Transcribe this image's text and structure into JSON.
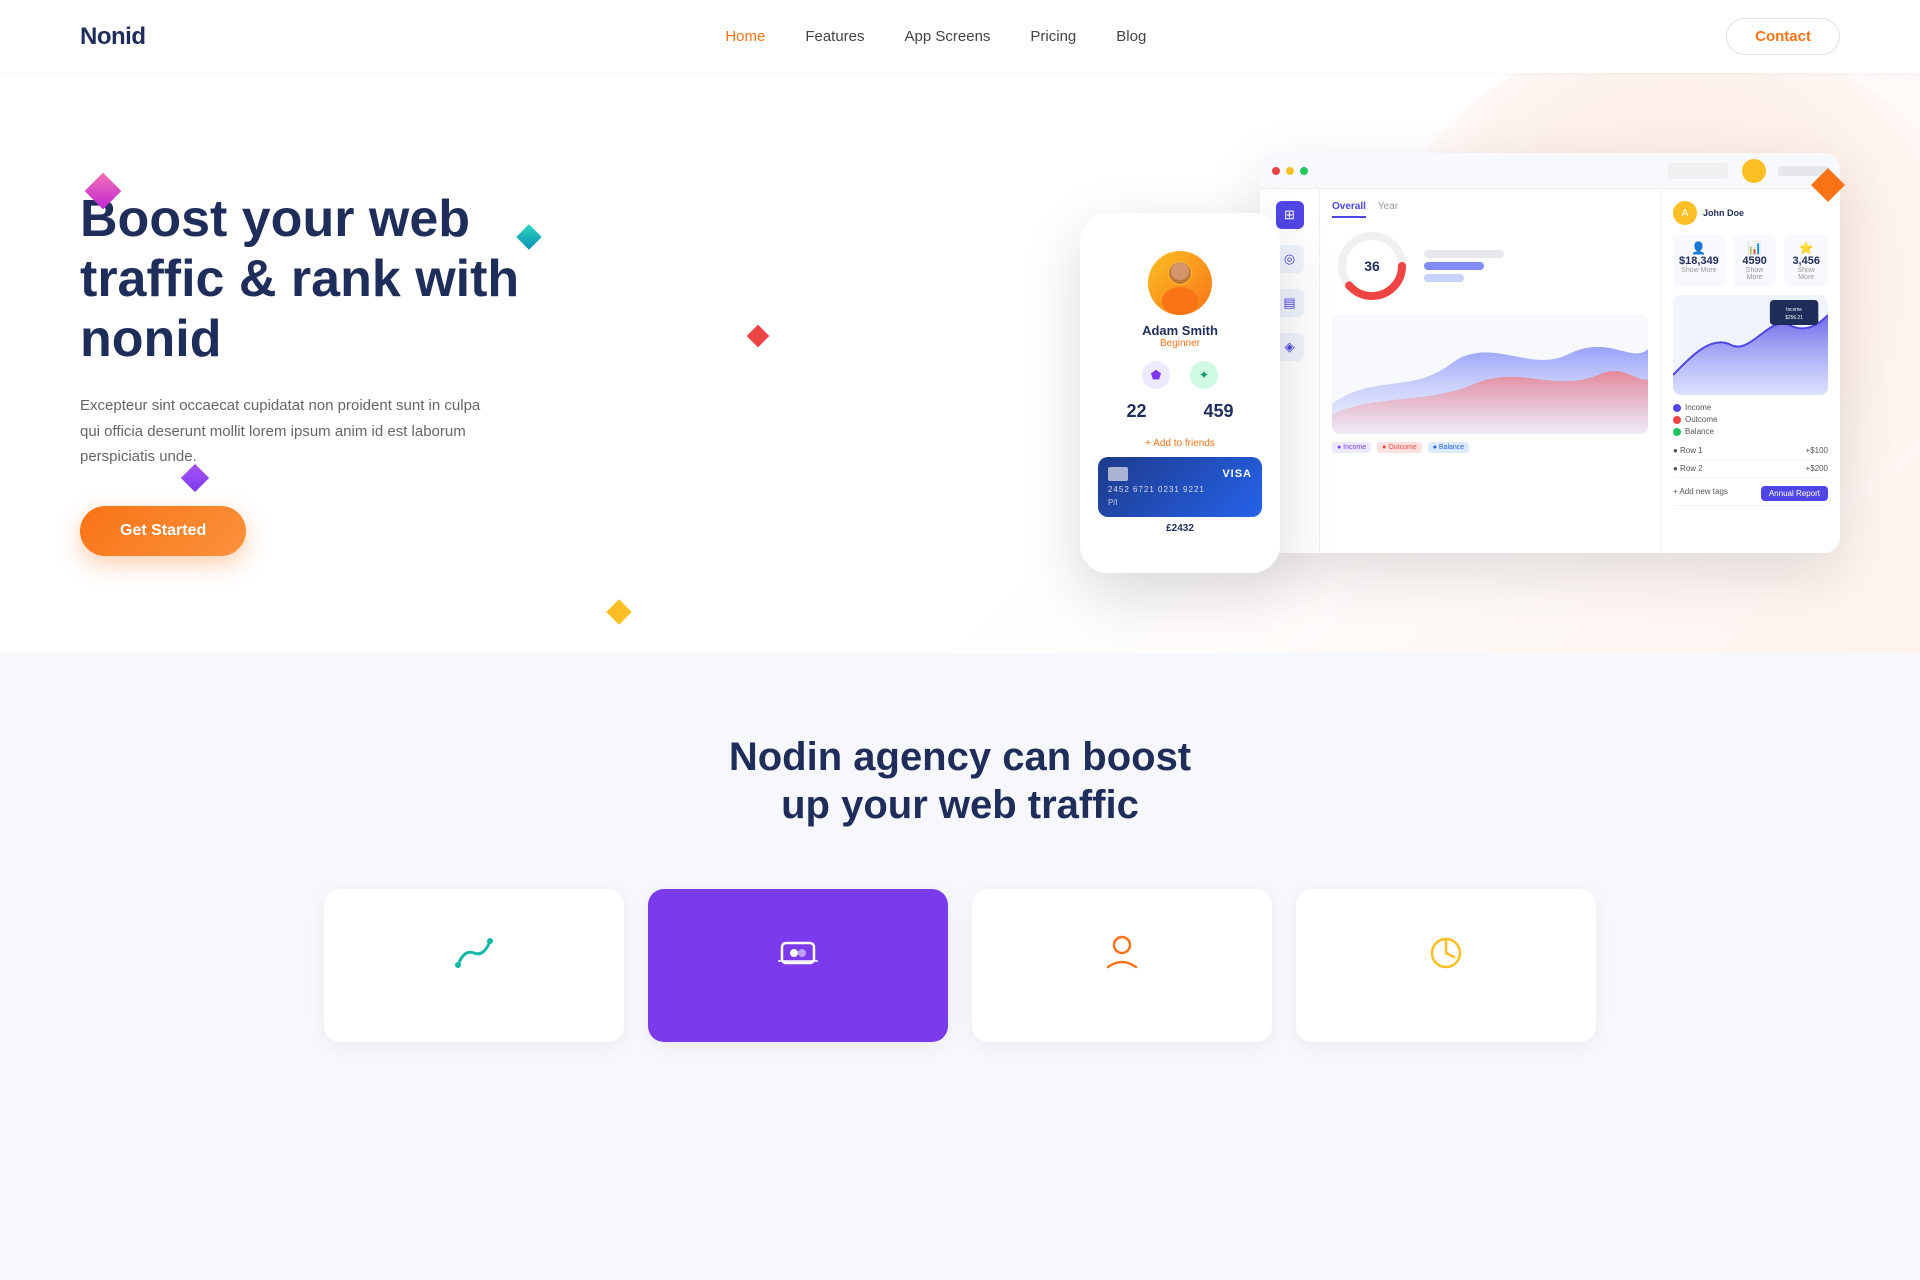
{
  "brand": {
    "name": "Nonid"
  },
  "nav": {
    "links": [
      {
        "label": "Home",
        "active": true
      },
      {
        "label": "Features",
        "active": false
      },
      {
        "label": "App Screens",
        "active": false
      },
      {
        "label": "Pricing",
        "active": false
      },
      {
        "label": "Blog",
        "active": false
      }
    ],
    "contact_label": "Contact"
  },
  "hero": {
    "headline": "Boost your web traffic & rank with nonid",
    "description": "Excepteur sint occaecat cupidatat non proident sunt in culpa qui officia deserunt mollit lorem ipsum anim id est laborum perspiciatis unde.",
    "cta_label": "Get Started"
  },
  "phone_card": {
    "user_name": "Adam Smith",
    "user_role": "Beginner",
    "stat1_num": "22",
    "stat1_label": "",
    "stat2_num": "459",
    "stat2_label": "",
    "add_friends": "+ Add to friends",
    "visa_label": "VISA",
    "card_number": "2452  6721  0231  9221",
    "card_exp": "P/I",
    "card_balance": "£2432"
  },
  "dashboard": {
    "tabs": [
      "Overall",
      "Year"
    ],
    "stats": [
      {
        "value": "$18,349",
        "label": "Show More"
      },
      {
        "value": "4590",
        "label": "Show More"
      },
      {
        "value": "3,456",
        "label": "Show More"
      }
    ],
    "gauge_value": "36",
    "chart_legend": [
      "Income",
      "Outcome",
      "Balance"
    ],
    "annual_btn": "Annual Report"
  },
  "section2": {
    "headline": "Nodin agency can boost\nup your web traffic"
  },
  "colors": {
    "primary": "#f97316",
    "dark": "#1e2d5a",
    "purple": "#7c3aed"
  }
}
